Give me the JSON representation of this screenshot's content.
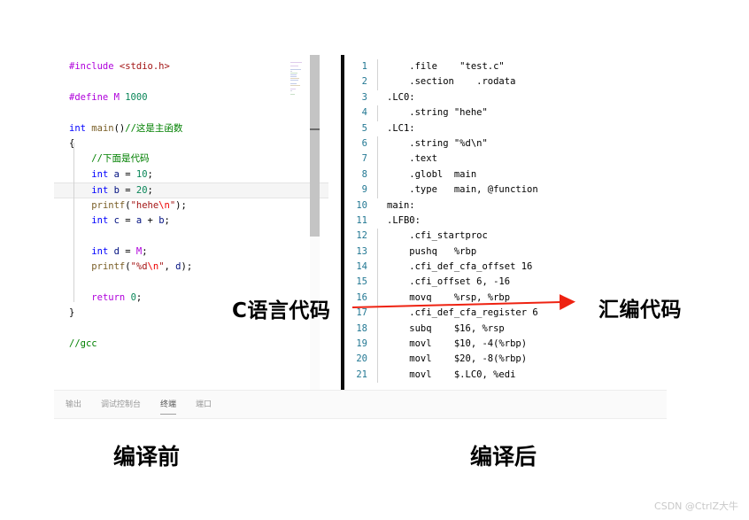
{
  "editor": {
    "c_pane": {
      "language": "c",
      "current_line_index": 8,
      "lines": [
        [
          {
            "t": "#include ",
            "c": "pre"
          },
          {
            "t": "<stdio.h>",
            "c": "inc"
          }
        ],
        [],
        [
          {
            "t": "#define ",
            "c": "pre"
          },
          {
            "t": "M",
            "c": "macro"
          },
          {
            "t": " ",
            "c": "plain"
          },
          {
            "t": "1000",
            "c": "num"
          }
        ],
        [],
        [
          {
            "t": "int",
            "c": "kw"
          },
          {
            "t": " ",
            "c": "plain"
          },
          {
            "t": "main",
            "c": "fn"
          },
          {
            "t": "()",
            "c": "plain"
          },
          {
            "t": "//这是主函数",
            "c": "cmt"
          }
        ],
        [
          {
            "t": "{",
            "c": "plain"
          }
        ],
        [
          {
            "t": "    ",
            "c": "plain"
          },
          {
            "t": "//下面是代码",
            "c": "cmt"
          }
        ],
        [
          {
            "t": "    ",
            "c": "plain"
          },
          {
            "t": "int",
            "c": "kw"
          },
          {
            "t": " ",
            "c": "plain"
          },
          {
            "t": "a",
            "c": "id"
          },
          {
            "t": " = ",
            "c": "plain"
          },
          {
            "t": "10",
            "c": "num"
          },
          {
            "t": ";",
            "c": "plain"
          }
        ],
        [
          {
            "t": "    ",
            "c": "plain"
          },
          {
            "t": "int",
            "c": "kw"
          },
          {
            "t": " ",
            "c": "plain"
          },
          {
            "t": "b",
            "c": "id"
          },
          {
            "t": " = ",
            "c": "plain"
          },
          {
            "t": "20",
            "c": "num"
          },
          {
            "t": ";",
            "c": "plain"
          }
        ],
        [
          {
            "t": "    ",
            "c": "plain"
          },
          {
            "t": "printf",
            "c": "fn"
          },
          {
            "t": "(",
            "c": "plain"
          },
          {
            "t": "\"hehe",
            "c": "str"
          },
          {
            "t": "\\n",
            "c": "esc"
          },
          {
            "t": "\"",
            "c": "str"
          },
          {
            "t": ");",
            "c": "plain"
          }
        ],
        [
          {
            "t": "    ",
            "c": "plain"
          },
          {
            "t": "int",
            "c": "kw"
          },
          {
            "t": " ",
            "c": "plain"
          },
          {
            "t": "c",
            "c": "id"
          },
          {
            "t": " = ",
            "c": "plain"
          },
          {
            "t": "a",
            "c": "id"
          },
          {
            "t": " + ",
            "c": "plain"
          },
          {
            "t": "b",
            "c": "id"
          },
          {
            "t": ";",
            "c": "plain"
          }
        ],
        [],
        [
          {
            "t": "    ",
            "c": "plain"
          },
          {
            "t": "int",
            "c": "kw"
          },
          {
            "t": " ",
            "c": "plain"
          },
          {
            "t": "d",
            "c": "id"
          },
          {
            "t": " = ",
            "c": "plain"
          },
          {
            "t": "M",
            "c": "macro"
          },
          {
            "t": ";",
            "c": "plain"
          }
        ],
        [
          {
            "t": "    ",
            "c": "plain"
          },
          {
            "t": "printf",
            "c": "fn"
          },
          {
            "t": "(",
            "c": "plain"
          },
          {
            "t": "\"%d",
            "c": "str"
          },
          {
            "t": "\\n",
            "c": "esc"
          },
          {
            "t": "\"",
            "c": "str"
          },
          {
            "t": ", ",
            "c": "plain"
          },
          {
            "t": "d",
            "c": "id"
          },
          {
            "t": ");",
            "c": "plain"
          }
        ],
        [],
        [
          {
            "t": "    ",
            "c": "plain"
          },
          {
            "t": "return",
            "c": "pre"
          },
          {
            "t": " ",
            "c": "plain"
          },
          {
            "t": "0",
            "c": "num"
          },
          {
            "t": ";",
            "c": "plain"
          }
        ],
        [
          {
            "t": "}",
            "c": "plain"
          }
        ],
        [],
        [
          {
            "t": "//gcc",
            "c": "cmt"
          }
        ]
      ]
    },
    "asm_pane": {
      "language": "asm",
      "rows": [
        {
          "num": "1",
          "indented": true,
          "text": "    .file    \"test.c\""
        },
        {
          "num": "2",
          "indented": true,
          "text": "    .section    .rodata"
        },
        {
          "num": "3",
          "indented": false,
          "text": ".LC0:"
        },
        {
          "num": "4",
          "indented": true,
          "text": "    .string \"hehe\""
        },
        {
          "num": "5",
          "indented": false,
          "text": ".LC1:"
        },
        {
          "num": "6",
          "indented": true,
          "text": "    .string \"%d\\n\""
        },
        {
          "num": "7",
          "indented": true,
          "text": "    .text"
        },
        {
          "num": "8",
          "indented": true,
          "text": "    .globl  main"
        },
        {
          "num": "9",
          "indented": true,
          "text": "    .type   main, @function"
        },
        {
          "num": "10",
          "indented": false,
          "text": "main:"
        },
        {
          "num": "11",
          "indented": false,
          "text": ".LFB0:"
        },
        {
          "num": "12",
          "indented": true,
          "text": "    .cfi_startproc"
        },
        {
          "num": "13",
          "indented": true,
          "text": "    pushq   %rbp"
        },
        {
          "num": "14",
          "indented": true,
          "text": "    .cfi_def_cfa_offset 16"
        },
        {
          "num": "15",
          "indented": true,
          "text": "    .cfi_offset 6, -16"
        },
        {
          "num": "16",
          "indented": true,
          "text": "    movq    %rsp, %rbp"
        },
        {
          "num": "17",
          "indented": true,
          "text": "    .cfi_def_cfa_register 6"
        },
        {
          "num": "18",
          "indented": true,
          "text": "    subq    $16, %rsp"
        },
        {
          "num": "19",
          "indented": true,
          "text": "    movl    $10, -4(%rbp)"
        },
        {
          "num": "20",
          "indented": true,
          "text": "    movl    $20, -8(%rbp)"
        },
        {
          "num": "21",
          "indented": true,
          "text": "    movl    $.LC0, %edi"
        }
      ]
    }
  },
  "panel": {
    "tabs": [
      {
        "label": "输出",
        "active": false
      },
      {
        "label": "调试控制台",
        "active": false
      },
      {
        "label": "终端",
        "active": true
      },
      {
        "label": "端口",
        "active": false
      }
    ]
  },
  "annotations": {
    "caption_c": "C语言代码",
    "caption_asm": "汇编代码",
    "label_before": "编译前",
    "label_after": "编译后",
    "arrow_color": "#ee2211"
  },
  "watermark": {
    "text": "CSDN @CtrlZ大牛"
  },
  "colors": {
    "background": "#ffffff",
    "divider": "#0b0b0b",
    "line_number": "#237893",
    "current_line_bg": "#f5f5f5",
    "scrollbar_thumb": "#c4c4c4",
    "arrow": "#ee2211",
    "watermark": "#c9c9c9"
  }
}
